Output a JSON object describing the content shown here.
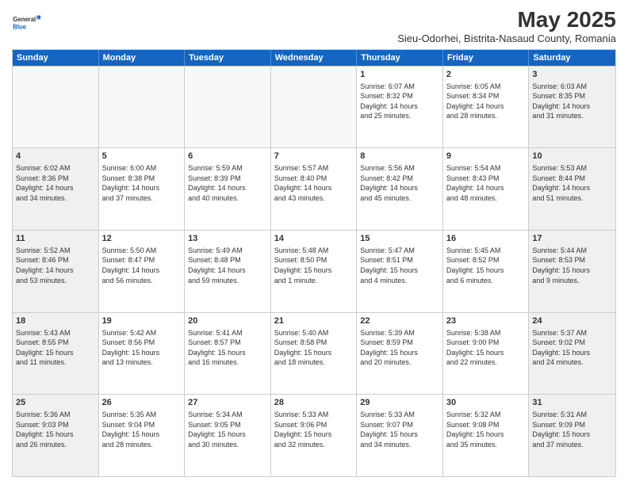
{
  "logo": {
    "general": "General",
    "blue": "Blue"
  },
  "title": "May 2025",
  "subtitle": "Sieu-Odorhei, Bistrita-Nasaud County, Romania",
  "dayHeaders": [
    "Sunday",
    "Monday",
    "Tuesday",
    "Wednesday",
    "Thursday",
    "Friday",
    "Saturday"
  ],
  "weeks": [
    [
      {
        "num": "",
        "info": "",
        "empty": true
      },
      {
        "num": "",
        "info": "",
        "empty": true
      },
      {
        "num": "",
        "info": "",
        "empty": true
      },
      {
        "num": "",
        "info": "",
        "empty": true
      },
      {
        "num": "1",
        "info": "Sunrise: 6:07 AM\nSunset: 8:32 PM\nDaylight: 14 hours\nand 25 minutes.",
        "empty": false
      },
      {
        "num": "2",
        "info": "Sunrise: 6:05 AM\nSunset: 8:34 PM\nDaylight: 14 hours\nand 28 minutes.",
        "empty": false
      },
      {
        "num": "3",
        "info": "Sunrise: 6:03 AM\nSunset: 8:35 PM\nDaylight: 14 hours\nand 31 minutes.",
        "empty": false
      }
    ],
    [
      {
        "num": "4",
        "info": "Sunrise: 6:02 AM\nSunset: 8:36 PM\nDaylight: 14 hours\nand 34 minutes.",
        "empty": false
      },
      {
        "num": "5",
        "info": "Sunrise: 6:00 AM\nSunset: 8:38 PM\nDaylight: 14 hours\nand 37 minutes.",
        "empty": false
      },
      {
        "num": "6",
        "info": "Sunrise: 5:59 AM\nSunset: 8:39 PM\nDaylight: 14 hours\nand 40 minutes.",
        "empty": false
      },
      {
        "num": "7",
        "info": "Sunrise: 5:57 AM\nSunset: 8:40 PM\nDaylight: 14 hours\nand 43 minutes.",
        "empty": false
      },
      {
        "num": "8",
        "info": "Sunrise: 5:56 AM\nSunset: 8:42 PM\nDaylight: 14 hours\nand 45 minutes.",
        "empty": false
      },
      {
        "num": "9",
        "info": "Sunrise: 5:54 AM\nSunset: 8:43 PM\nDaylight: 14 hours\nand 48 minutes.",
        "empty": false
      },
      {
        "num": "10",
        "info": "Sunrise: 5:53 AM\nSunset: 8:44 PM\nDaylight: 14 hours\nand 51 minutes.",
        "empty": false
      }
    ],
    [
      {
        "num": "11",
        "info": "Sunrise: 5:52 AM\nSunset: 8:46 PM\nDaylight: 14 hours\nand 53 minutes.",
        "empty": false
      },
      {
        "num": "12",
        "info": "Sunrise: 5:50 AM\nSunset: 8:47 PM\nDaylight: 14 hours\nand 56 minutes.",
        "empty": false
      },
      {
        "num": "13",
        "info": "Sunrise: 5:49 AM\nSunset: 8:48 PM\nDaylight: 14 hours\nand 59 minutes.",
        "empty": false
      },
      {
        "num": "14",
        "info": "Sunrise: 5:48 AM\nSunset: 8:50 PM\nDaylight: 15 hours\nand 1 minute.",
        "empty": false
      },
      {
        "num": "15",
        "info": "Sunrise: 5:47 AM\nSunset: 8:51 PM\nDaylight: 15 hours\nand 4 minutes.",
        "empty": false
      },
      {
        "num": "16",
        "info": "Sunrise: 5:45 AM\nSunset: 8:52 PM\nDaylight: 15 hours\nand 6 minutes.",
        "empty": false
      },
      {
        "num": "17",
        "info": "Sunrise: 5:44 AM\nSunset: 8:53 PM\nDaylight: 15 hours\nand 9 minutes.",
        "empty": false
      }
    ],
    [
      {
        "num": "18",
        "info": "Sunrise: 5:43 AM\nSunset: 8:55 PM\nDaylight: 15 hours\nand 11 minutes.",
        "empty": false
      },
      {
        "num": "19",
        "info": "Sunrise: 5:42 AM\nSunset: 8:56 PM\nDaylight: 15 hours\nand 13 minutes.",
        "empty": false
      },
      {
        "num": "20",
        "info": "Sunrise: 5:41 AM\nSunset: 8:57 PM\nDaylight: 15 hours\nand 16 minutes.",
        "empty": false
      },
      {
        "num": "21",
        "info": "Sunrise: 5:40 AM\nSunset: 8:58 PM\nDaylight: 15 hours\nand 18 minutes.",
        "empty": false
      },
      {
        "num": "22",
        "info": "Sunrise: 5:39 AM\nSunset: 8:59 PM\nDaylight: 15 hours\nand 20 minutes.",
        "empty": false
      },
      {
        "num": "23",
        "info": "Sunrise: 5:38 AM\nSunset: 9:00 PM\nDaylight: 15 hours\nand 22 minutes.",
        "empty": false
      },
      {
        "num": "24",
        "info": "Sunrise: 5:37 AM\nSunset: 9:02 PM\nDaylight: 15 hours\nand 24 minutes.",
        "empty": false
      }
    ],
    [
      {
        "num": "25",
        "info": "Sunrise: 5:36 AM\nSunset: 9:03 PM\nDaylight: 15 hours\nand 26 minutes.",
        "empty": false
      },
      {
        "num": "26",
        "info": "Sunrise: 5:35 AM\nSunset: 9:04 PM\nDaylight: 15 hours\nand 28 minutes.",
        "empty": false
      },
      {
        "num": "27",
        "info": "Sunrise: 5:34 AM\nSunset: 9:05 PM\nDaylight: 15 hours\nand 30 minutes.",
        "empty": false
      },
      {
        "num": "28",
        "info": "Sunrise: 5:33 AM\nSunset: 9:06 PM\nDaylight: 15 hours\nand 32 minutes.",
        "empty": false
      },
      {
        "num": "29",
        "info": "Sunrise: 5:33 AM\nSunset: 9:07 PM\nDaylight: 15 hours\nand 34 minutes.",
        "empty": false
      },
      {
        "num": "30",
        "info": "Sunrise: 5:32 AM\nSunset: 9:08 PM\nDaylight: 15 hours\nand 35 minutes.",
        "empty": false
      },
      {
        "num": "31",
        "info": "Sunrise: 5:31 AM\nSunset: 9:09 PM\nDaylight: 15 hours\nand 37 minutes.",
        "empty": false
      }
    ]
  ]
}
